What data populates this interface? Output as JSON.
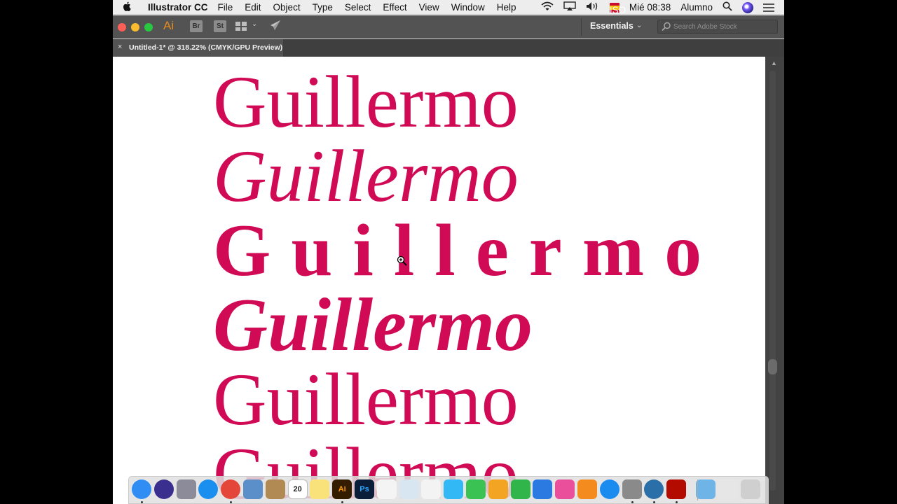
{
  "menubar": {
    "app_name": "Illustrator CC",
    "items": [
      "File",
      "Edit",
      "Object",
      "Type",
      "Select",
      "Effect",
      "View",
      "Window",
      "Help"
    ],
    "clock": "Mié 08:38",
    "user": "Alumno",
    "input_flag_label": "ISO"
  },
  "appbar": {
    "app_logo": "Ai",
    "bridge_label": "Br",
    "stock_label": "St",
    "workspace": "Essentials",
    "search_placeholder": "Search Adobe Stock"
  },
  "document_tab": {
    "close": "×",
    "title": "Untitled-1* @ 318.22% (CMYK/GPU Preview)"
  },
  "canvas": {
    "text_color": "#d10a55",
    "words": [
      {
        "text": "Guillermo",
        "style": "regular"
      },
      {
        "text": "Guillermo",
        "style": "italic"
      },
      {
        "text": "Guillermo",
        "style": "bold-tracked"
      },
      {
        "text": "Guillermo",
        "style": "bold-italic"
      },
      {
        "text": "Guillermo",
        "style": "regular"
      },
      {
        "text": "Guillermo",
        "style": "regular-cropped"
      }
    ]
  },
  "dock": {
    "apps": [
      {
        "name": "Finder",
        "icon": "finder-icon",
        "color": "#2f8df3",
        "running": true
      },
      {
        "name": "Siri",
        "icon": "siri-icon",
        "color": "#3a2f8f",
        "running": false
      },
      {
        "name": "Launchpad",
        "icon": "rocket-icon",
        "color": "#8b8b99",
        "running": false
      },
      {
        "name": "Safari",
        "icon": "compass-icon",
        "color": "#1b8ff0",
        "running": false
      },
      {
        "name": "Chrome",
        "icon": "chrome-icon",
        "color": "#e4473a",
        "running": true
      },
      {
        "name": "Preview",
        "icon": "photo-icon",
        "color": "#5a8fc9",
        "running": false
      },
      {
        "name": "Contacts",
        "icon": "book-icon",
        "color": "#b08a52",
        "running": false
      },
      {
        "name": "Calendar",
        "icon": "calendar-icon",
        "color": "#ffffff",
        "running": false,
        "label": "20"
      },
      {
        "name": "Notes",
        "icon": "note-icon",
        "color": "#f9e27a",
        "running": false
      },
      {
        "name": "Illustrator",
        "icon": "ai-icon",
        "color": "#331c00",
        "running": true,
        "label": "Ai"
      },
      {
        "name": "Photoshop",
        "icon": "ps-icon",
        "color": "#0a1e3a",
        "running": false,
        "label": "Ps"
      },
      {
        "name": "Reminders",
        "icon": "list-icon",
        "color": "#f4f4f4",
        "running": false
      },
      {
        "name": "Preview",
        "icon": "preview-icon",
        "color": "#d8e6f2",
        "running": false
      },
      {
        "name": "Photos",
        "icon": "flower-icon",
        "color": "#f3f3f3",
        "running": false
      },
      {
        "name": "Messages",
        "icon": "chat-icon",
        "color": "#31b8f5",
        "running": false
      },
      {
        "name": "FaceTime",
        "icon": "video-icon",
        "color": "#3ac252",
        "running": false
      },
      {
        "name": "Pages",
        "icon": "pencil-icon",
        "color": "#f3a422",
        "running": false
      },
      {
        "name": "Numbers",
        "icon": "bar-chart-icon",
        "color": "#2fb54a",
        "running": false
      },
      {
        "name": "Keynote",
        "icon": "podium-icon",
        "color": "#2a7ae2",
        "running": false
      },
      {
        "name": "iTunes",
        "icon": "music-icon",
        "color": "#ea4f9b",
        "running": false
      },
      {
        "name": "iBooks",
        "icon": "open-book-icon",
        "color": "#f38b1f",
        "running": false
      },
      {
        "name": "App Store",
        "icon": "app-store-icon",
        "color": "#1a8cf0",
        "running": false
      },
      {
        "name": "System Preferences",
        "icon": "gear-icon",
        "color": "#8a8a8a",
        "running": true
      },
      {
        "name": "QuickTime",
        "icon": "quicktime-icon",
        "color": "#2a6fa8",
        "running": true
      },
      {
        "name": "Acrobat",
        "icon": "pdf-icon",
        "color": "#b30b00",
        "running": true
      },
      {
        "name": "Downloads",
        "icon": "folder-icon",
        "color": "#6fb4e6",
        "running": false
      },
      {
        "name": "Documents",
        "icon": "stack-icon",
        "color": "#e6e6e6",
        "running": false
      },
      {
        "name": "Trash",
        "icon": "trash-icon",
        "color": "#cfcfcf",
        "running": false
      }
    ]
  }
}
